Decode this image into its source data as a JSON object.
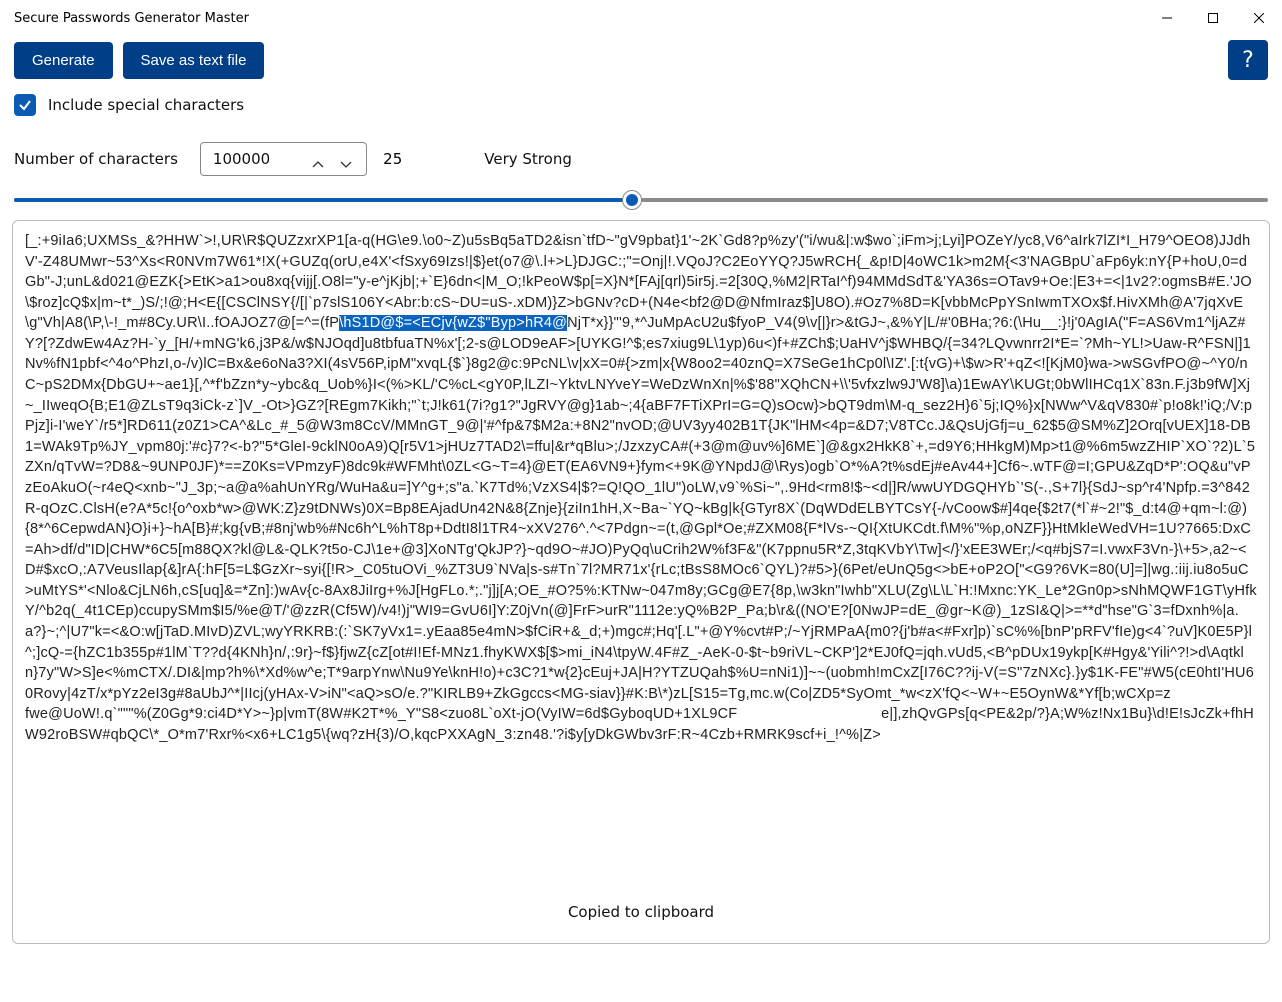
{
  "window": {
    "title": "Secure Passwords Generator Master"
  },
  "toolbar": {
    "generate_label": "Generate",
    "save_label": "Save as text file",
    "help_label": "?"
  },
  "options": {
    "include_special_label": "Include special characters",
    "include_special_checked": true
  },
  "numchars": {
    "label": "Number of characters",
    "value": "100000",
    "strength_number": "25",
    "strength_text": "Very Strong"
  },
  "slider": {
    "fill_percent": 49.3
  },
  "output": {
    "lines_pre": "[_:+9iIa6;UXMSs_&?HHW`>!,UR\\R$QUZzxrXP1[a-q(HG\\e9.\\o0~Z)u5sBq5aTD2&isn`tfD~\"gV9pbat}1'~2K`Gd8?p%zy'(\"i/wu&|:w$wo`;iFm>j;Lyi]POZeY/yc8,V6^aIrk7lZI*I_H79^OEO8)JJdhV'-Z48UMwr~53^Xs<R0NVm7W61*!X(+GUZq(orU,e4X'<fSxy69Izs!|$}et(o7@\\.l+>L}DJGC:;\"=Onj|!.VQoJ?C2EoYYQ?J5wRCH{_&p!D|4oWC1k>m2M{<3'NAGBpU`aFp6yk:nY{P+hoU,0=dGb\"-J;unL&d021@EZK{>EtK>a1>ou8xq{vijj[.O8l=\"y-e^jKjb|;+`E}6dn<|M_O;!kPeoW$p[=X}N*[FAj[qrl)5ir5j.=2[30Q,%M2|RTaI^f)94MMdSdT&'YA36s=OTav9+Oe:|E3+=<|1v2?:ogmsB#E.'JO\\$roz]cQ$x|m~t*_)S/;!@;H<E{[CSClNSY{/[|`p7slS106Y<Abr:b:cS~DU=uS-.xDM)}Z>bGNv?cD+(N4e<bf2@D@NfmIraz$]U8O).#Oz7%8D=K[vbbMcPpYSnIwmTXOx$f.HivXMh@A'7jqXvE\\g\"Vh|A8(\\P,\\-!_m#8Cy.UR\\I..fOAJOZ7@[=^=(fP",
    "selection": "\\hS1D@$=<ECjv{wZ$\"Byp>hR4@",
    "lines_post": "NjT*x}}\"'9,*^JuMpAcU2u$fyoP_V4(9\\v[|}r>&tGJ~,&%Y|L/#'0BHa;?6:(\\Hu__:}!j'0AgIA(\"F=AS6Vm1^ljAZ#Y?[?ZdwEw4Az?H-`y_[H/+mNG'k6,j3P&/w$NJOqd]u8tbfuaTN%x'[;2-s@LOD9eAF>[UYKG!^$;es7xiug9L\\1yp)6u<)f+#ZCh$;UaHV^j$WHBQ/{=34?LQvwnrr2I*E=`?Mh~YL!>Uaw-R^FSN|]1Nv%fN1pbf<^4o^PhzI,o-/v)lC=Bx&e6oNa3?XI(4sV56P,ipM\"xvqL{$`}8g2@c:9PcNL\\v|xX=0#{>zm|x{W8oo2=40znQ=X7SeGe1hCp0l\\IZ'.[:t{vG)+\\$w>R'+qZ<![KjM0}wa->wSGvfPO@~^Y0/nC~pS2DMx{DbGU+~ae1}[,^*f'bZzn*y~ybc&q_Uob%}I<(%>KL/'C%cL<gY0P,lLZI~YktvLNYveY=WeDzWnXn|%$'88\"XQhCN+\\\\'5vfxzlw9J'W8]\\a)1EwAY\\KUGt;0bWlIHCq1X`83n.F.j3b9fW]Xj~_IIweqO{B;E1@ZLsT9q3iCk-z`]V_-Ot>}GZ?[REgm7Kikh;\"`t;J!k61(7i?g1?\"JgRVY@g}1ab~;4{aBF7FTiXPrI=G=Q)sOcw}>bQT9dm\\M-q_sez2H}6`5j;IQ%}x[NWw^V&qV830#`p!o8k!'iQ;/V:pPjz]i-I'weY`/r5*]RD611(z0Z1>CA^&Lc_#_5@W3m8CcV/MMnGT_9@|'#^fp&7$M2a:+8N2\"nvOD;@UV3yy402B1T{JK\"lHM<4p=&D7;V8TCc.J&QsUjGfj=u_62$5@SM%Z]2Orq[vUEX]18-DB1=WAk9Tp%JY_vpm80j:'#c}7?<-b?\"5*GleI-9cklN0oA9)Q[r5V1>jHUz7TAD2\\=ffu|&r*qBlu>;/JzxzyCA#(+3@m@uv%]6ME`]@&gx2HkK8`+,=d9Y6;HHkgM)Mp>t1@%6m5wzZHIP`XO`?2)L`5ZXn/qTvW=?D8&~9UNP0JF)*==Z0Ks=VPmzyF)8dc9k#WFMht\\0ZL<G~T=4}@ET(EA6VN9+}fym<+9K@YNpdJ@\\Rys)ogb`O*%A?t%sdEj#eAv44+]Cf6~.wTF@=I;GPU&ZqD*P':OQ&u\"vPzEoAkuO(~r4eQ<xnb~\"J_3p;~a@a%ahUnYRg/WuHa&u=]Y^g+;s\"a.`K7Td%;VzXS4|$?=Q!QO_1lU\")oLW,v9`%Si~\",.9Hd<rm8!$~<d|]R/wwUYDGQHYb`'S(-.,S+7l}{SdJ~sp^r4'Npfp.=3^842R-qOzC.ClsH(e?A*5c!{o^oxb*w>@WK:Z}z9tDNWs)0X=Bp8EAjadUn42N&8{Znje}{ziIn1hH,X~Ba~`YQ~kBg|k{GTyr8X`(DqWDdELBYTCsY{-/vCoow$#]4qe{$2t7(*l`#~2!\"$_d:t4@+qm~l:@){8*^6CepwdAN}O}i+}~hA[B}#;kg{vB;#8nj'wb%#Nc6h^L%hT8p+DdtI8l1TR4~xXV276^.^<7Pdgn~=(t,@Gpl*Oe;#ZXM08{F*lVs-~QI{XtUKCdt.f\\M%\"%p,oNZF}}HtMkleWedVH=1U?7665:DxC=Ah>df/d\"ID|CHW*6C5[m88QX?kl@L&-QLK?t5o-CJ\\1e+@3]XoNTg'QkJP?}~qd9O~#JO)PyQq\\uCrih2W%f3F&\"(K7ppnu5R*Z,3tqKVbY\\Tw]</}'xEE3WEr;/<q#bjS7=I.vwxF3Vn-}\\+5>,a2~<D#$xcO,:A7VeusIlap{&]rA{:hF[5=L$GzXr~syi{[!R>_C05tuOVi_%ZT3U9`NVa|s-s#Tn`7l?MR71x'{rLc;tBsS8MOc6`QYL)?#5>}(6Pet/eUnQ5g<>bE+oP2O[\"<G9?6VK=80(U]=]|wg.:iij.iu8o5uC>uMtYS*'<Nlo&CjLN6h,cS[uq]&=*Zn]:)wAv{c-8Ax8JiIrg+%J[HgFLo.*;.\"j]j[A;OE_#O?5%:KTNw~047m8y;GCg@E7{8p,\\w3kn\"Iwhb\"XLU(Zg\\L\\L`H:!Mxnc:YK_Le*2Gn0p>sNhMQWF1GT\\yHfkY/^b2q(_4t1CEp)ccupySMm$I5/%e@T/'@zzR(Cf5W)/v4!)j\"WI9=GvU6I]Y:Z0jVn(@]FrF>urR\"1112e:yQ%B2P_Pa;b\\r&((NO'E?[0NwJP=dE_@gr~K@)_1zSI&Q|>=**d\"hse\"G`3=fDxnh%|a.a?}~;^|U7\"k=<&O:w[jTaD.MIvD)ZVL;wyYRKRB:(:`SK7yVx1=.yEaa85e4mN>$fCiR+&_d;+)mgc#;Hq'[.L\"+@Y%cvt#P;/~YjRMPaA{m0?{j'b#a<#Fxr]p)`sC%%[bnP'pRFV'fIe)g<4`?uV]K0E5P}l^;]cQ-={hZC1b355p#1lM`T??d{4KNh}n/,:9r}~f$}fjwZ{cZ[ot#I!Ef-MNz1.fhyKWX$[$>mi_iN4\\tpyW.4F#Z_-AeK-0-$t~b9riVL~CKP']2*EJ0fQ=jqh.vUd5,<B^pDUx19ykp[K#Hgy&'Yili^?!>d\\Aqtkln}7y\"W>S]e<%mCTX/.DI&|mp?h%\\*Xd%w^e;T*9arpYnw\\Nu9Ye\\knH!o)+c3C?1*w{2}cEuj+JA|H?YTZUQah$%U=nNi1)]~~(uobmh!mCxZ[I76C??ij-V(=S\"7zNXc}.}y$1K-FE\"#W5(cE0htI'HU60Rovy|4zT/x*pYz2eI3g#8aUbJ^*|IIcj(yHAx-V>iN\"<aQ>sO/e.?\"KIRLB9+ZkGgccs<MG-siav}}#K:B\\*)zL[S15=Tg,mc.w(Co|ZD5*SyOmt_*w<zX'fQ<~W+~E5OynW&*Yf[b;wCXp=z                             fwe@UoW!.q`\"\"\"%(Z0Gg*9:ci4D*Y>~}p|vmT(8W#K2T*%_Y\"S8<zuo8L`oXt-jO(VyIW=6d$GyboqUD+1XL9CF                                  e|],zhQvGPs[q<PE&2p/?}A;W%z!Nx1Bu}\\d!E!sJcZk+fhHW92roBSW#qbQC\\*_O*m7'Rxr%<x6+LC1g5\\{wq?zH{3)/O,kqcPXXAgN_3:zn48.'?i$y[yDkGWbv3rF:R~4Czb+RMRK9scf+i_!^%|Z>"
  },
  "toast": {
    "text": "Copied to clipboard"
  }
}
